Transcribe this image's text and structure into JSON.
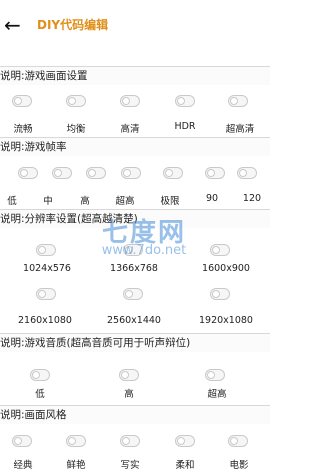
{
  "header": {
    "back_icon": "arrow-left-icon",
    "title": "DIY代码编辑"
  },
  "sections": [
    {
      "label": "说明:游戏画面设置",
      "options": [
        "流畅",
        "均衡",
        "高清",
        "HDR",
        "超高清"
      ]
    },
    {
      "label": "说明:游戏帧率",
      "options": [
        "低",
        "中",
        "高",
        "超高",
        "极限",
        "90",
        "120"
      ]
    },
    {
      "label": "说明:分辨率设置(超高越清楚)",
      "options": [
        "1024x576",
        "1366x768",
        "1600x900",
        "2160x1080",
        "2560x1440",
        "1920x1080"
      ]
    },
    {
      "label": "说明:游戏音质(超高音质可用于听声辩位)",
      "options": [
        "低",
        "高",
        "超高"
      ]
    },
    {
      "label": "说明:画面风格",
      "options": [
        "经典",
        "鲜艳",
        "写实",
        "柔和",
        "电影"
      ]
    }
  ],
  "watermark": {
    "main": "七度网",
    "url": "www.7do.net"
  },
  "colors": {
    "title": "#e0901a",
    "toggle_border": "#c9c9c9",
    "watermark": "#468cd7"
  }
}
